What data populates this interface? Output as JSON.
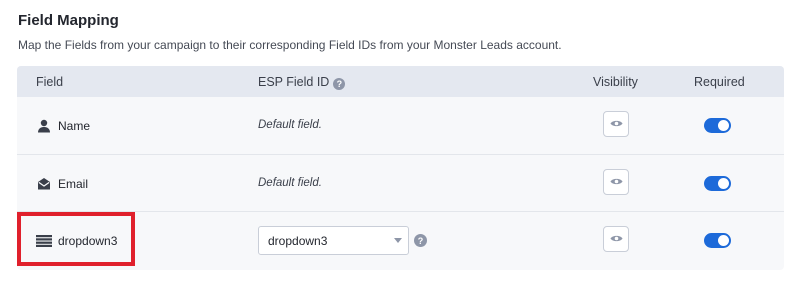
{
  "header": {
    "title": "Field Mapping",
    "subtitle": "Map the Fields from your campaign to their corresponding Field IDs from your Monster Leads account."
  },
  "table": {
    "columns": {
      "field": "Field",
      "esp_field_id": "ESP Field ID",
      "visibility": "Visibility",
      "required": "Required"
    },
    "rows": [
      {
        "field": "Name",
        "icon": "person-icon",
        "esp": "Default field.",
        "visible": true,
        "required": true
      },
      {
        "field": "Email",
        "icon": "envelope-open-icon",
        "esp": "Default field.",
        "visible": true,
        "required": true
      },
      {
        "field": "dropdown3",
        "icon": "dropdown-lines-icon",
        "esp_select": "dropdown3",
        "visible": true,
        "required": true
      }
    ]
  },
  "colors": {
    "toggle_on": "#1d6ad9",
    "highlight": "#e0202c",
    "header_bg": "#e4e8f0"
  },
  "help_glyph": "?"
}
